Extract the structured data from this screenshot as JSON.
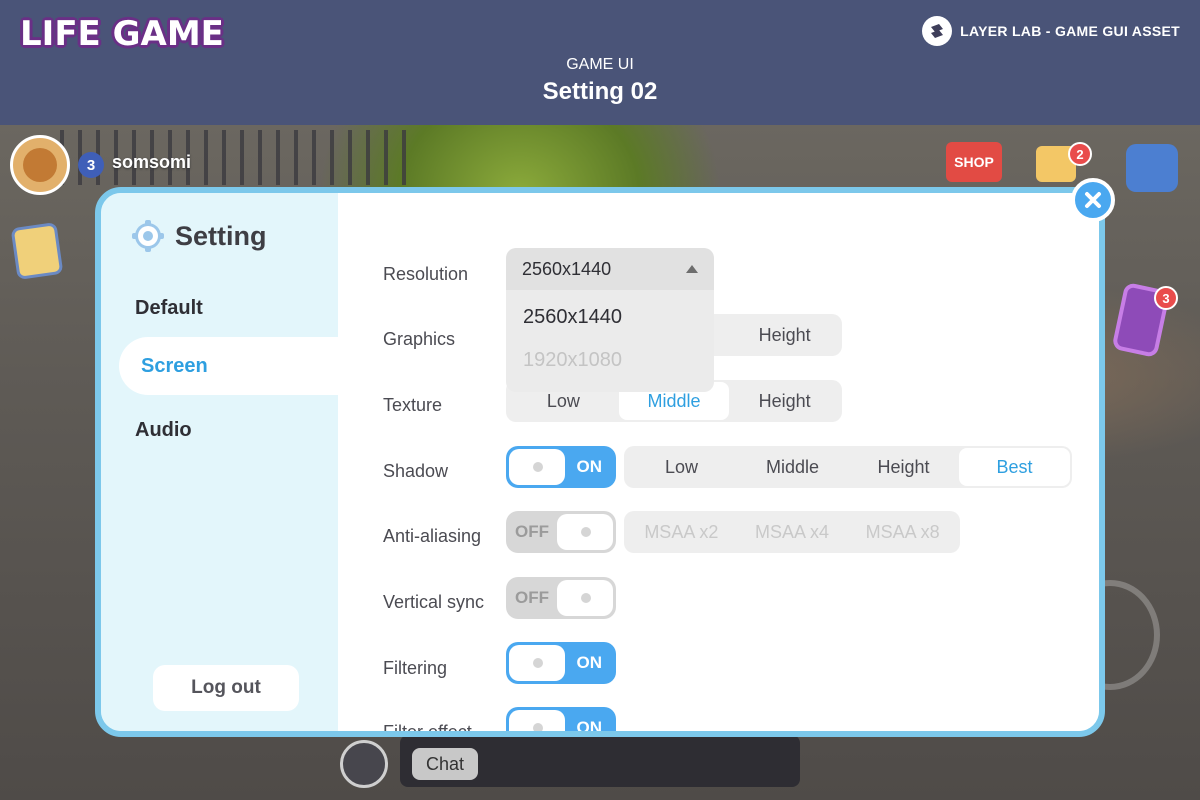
{
  "header": {
    "brand": "LIFE GAME",
    "credit": "LAYER LAB - GAME GUI ASSET",
    "subtitle": "GAME UI",
    "title": "Setting 02"
  },
  "hud": {
    "player_level": "3",
    "player_name": "somsomi",
    "shop_label": "SHOP",
    "mail_badge": "2",
    "phone_badge": "3",
    "chat_label": "Chat"
  },
  "settings": {
    "title": "Setting",
    "nav": [
      {
        "label": "Default"
      },
      {
        "label": "Screen"
      },
      {
        "label": "Audio"
      }
    ],
    "active_nav": "Screen",
    "logout_label": "Log out",
    "rows": {
      "resolution": {
        "label": "Resolution",
        "selected": "2560x1440",
        "options": [
          "2560x1440",
          "1920x1080"
        ]
      },
      "graphics": {
        "label": "Graphics",
        "visible_option": "Height"
      },
      "texture": {
        "label": "Texture",
        "options": [
          "Low",
          "Middle",
          "Height"
        ],
        "selected": "Middle"
      },
      "shadow": {
        "label": "Shadow",
        "toggle": "ON",
        "options": [
          "Low",
          "Middle",
          "Height",
          "Best"
        ],
        "selected": "Best"
      },
      "anti_aliasing": {
        "label": "Anti-aliasing",
        "toggle": "OFF",
        "options": [
          "MSAA x2",
          "MSAA x4",
          "MSAA x8"
        ]
      },
      "vertical_sync": {
        "label": "Vertical sync",
        "toggle": "OFF"
      },
      "filtering": {
        "label": "Filtering",
        "toggle": "ON"
      },
      "filter_effect": {
        "label": "Filter effect",
        "toggle": "ON"
      }
    }
  },
  "colors": {
    "header_bg": "#4a5478",
    "panel_border": "#7cc8eb",
    "sidebar_bg": "#e3f6fb",
    "accent_blue": "#2e9fe0",
    "toggle_on": "#4aa8f0",
    "toggle_off": "#d7d7d7"
  }
}
